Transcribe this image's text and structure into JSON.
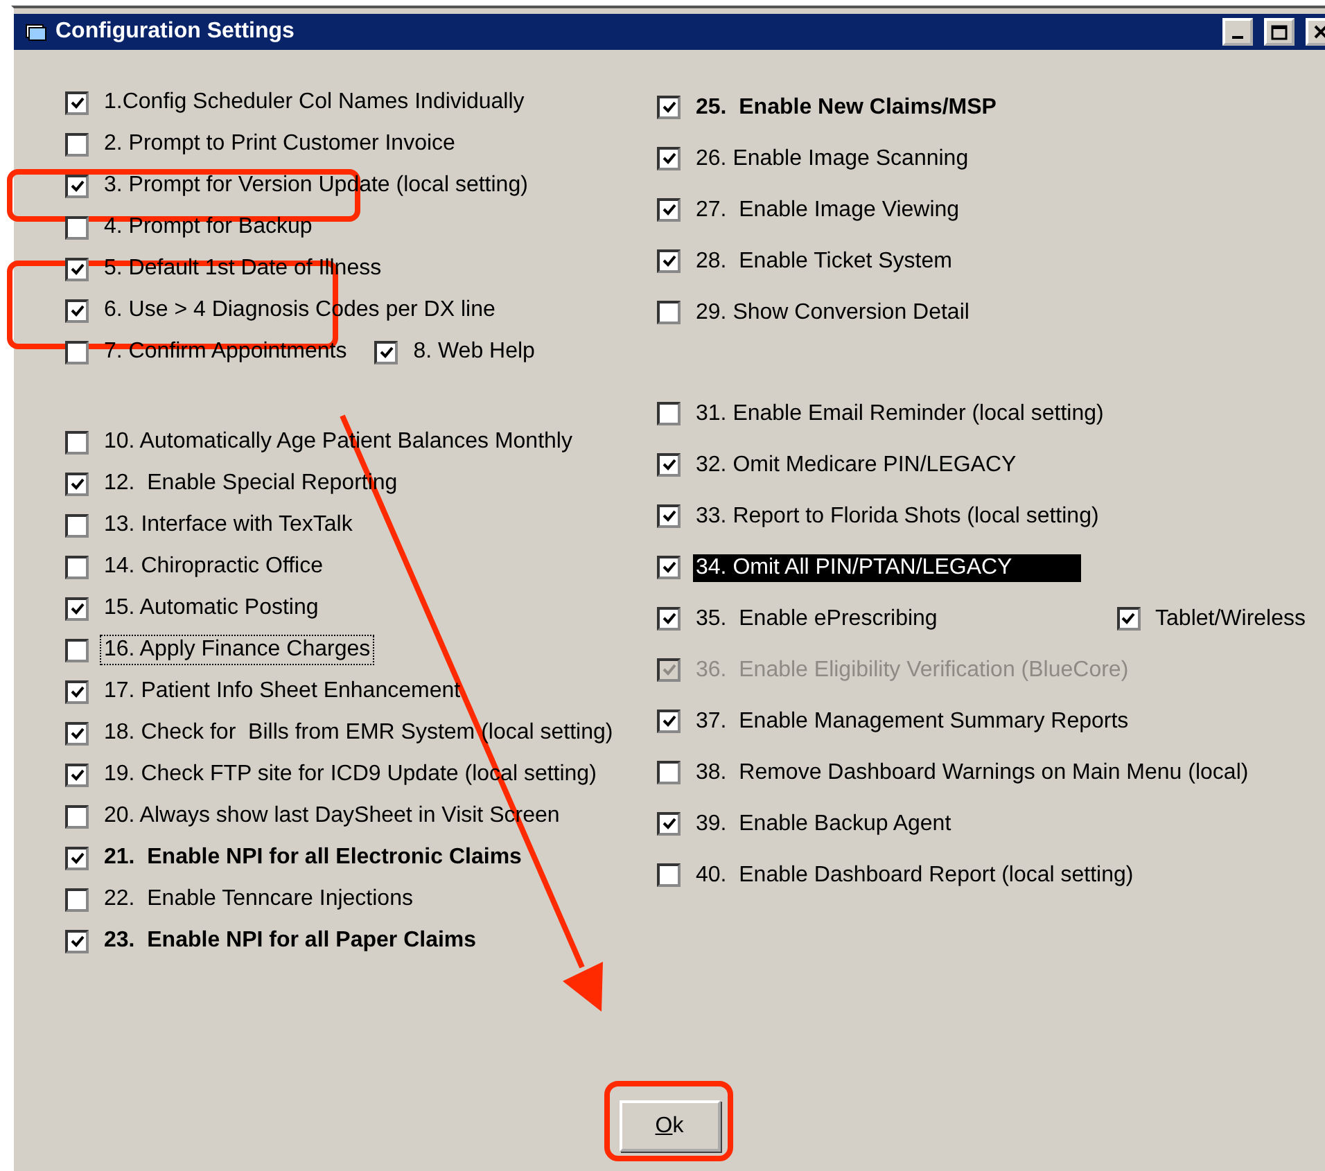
{
  "window": {
    "title": "Configuration Settings"
  },
  "columns": [
    {
      "groups": [
        [
          {
            "options": [
              {
                "label": "1.Config Scheduler Col Names Individually",
                "checked": true
              }
            ]
          },
          {
            "options": [
              {
                "label": "2. Prompt to Print Customer Invoice",
                "checked": false
              }
            ]
          },
          {
            "options": [
              {
                "label": "3. Prompt for Version Update (local setting)",
                "checked": true
              }
            ]
          },
          {
            "options": [
              {
                "label": "4. Prompt for Backup",
                "checked": false
              }
            ]
          },
          {
            "options": [
              {
                "label": "5. Default 1st Date of Illness",
                "checked": true
              }
            ]
          },
          {
            "options": [
              {
                "label": "6. Use > 4 Diagnosis Codes per DX line",
                "checked": true
              }
            ]
          },
          {
            "options": [
              {
                "label": "7. Confirm Appointments",
                "checked": false
              },
              {
                "label": "8. Web Help",
                "checked": true
              }
            ]
          }
        ],
        [
          {
            "options": [
              {
                "label": "10. Automatically Age Patient Balances Monthly",
                "checked": false
              }
            ]
          },
          {
            "options": [
              {
                "label": "12.  Enable Special Reporting",
                "checked": true
              }
            ]
          },
          {
            "options": [
              {
                "label": "13. Interface with TexTalk",
                "checked": false
              }
            ]
          },
          {
            "options": [
              {
                "label": "14. Chiropractic Office",
                "checked": false
              }
            ]
          },
          {
            "options": [
              {
                "label": "15. Automatic Posting",
                "checked": true
              }
            ]
          },
          {
            "options": [
              {
                "label": "16. Apply Finance Charges",
                "checked": false,
                "focused": true
              }
            ]
          },
          {
            "options": [
              {
                "label": "17. Patient Info Sheet Enhancement",
                "checked": true
              }
            ]
          },
          {
            "options": [
              {
                "label": "18. Check for  Bills from EMR System (local setting)",
                "checked": true
              }
            ]
          },
          {
            "options": [
              {
                "label": "19. Check FTP site for ICD9 Update (local setting)",
                "checked": true
              }
            ]
          },
          {
            "options": [
              {
                "label": "20. Always show last DaySheet in Visit Screen",
                "checked": false
              }
            ]
          },
          {
            "options": [
              {
                "label": "21.  Enable NPI for all Electronic Claims",
                "checked": true,
                "bold": true
              }
            ]
          },
          {
            "options": [
              {
                "label": "22.  Enable Tenncare Injections",
                "checked": false
              }
            ]
          },
          {
            "options": [
              {
                "label": "23.  Enable NPI for all Paper Claims",
                "checked": true,
                "bold": true
              }
            ]
          }
        ]
      ]
    },
    {
      "groups": [
        [
          {
            "options": [
              {
                "label": "25.  Enable New Claims/MSP",
                "checked": true,
                "bold": true
              }
            ]
          },
          {
            "options": [
              {
                "label": "26. Enable Image Scanning",
                "checked": true
              }
            ]
          },
          {
            "options": [
              {
                "label": "27.  Enable Image Viewing",
                "checked": true
              }
            ]
          },
          {
            "options": [
              {
                "label": "28.  Enable Ticket System",
                "checked": true
              }
            ]
          },
          {
            "options": [
              {
                "label": "29. Show Conversion Detail",
                "checked": false
              }
            ]
          }
        ],
        [
          {
            "options": [
              {
                "label": "31. Enable Email Reminder (local setting)",
                "checked": false
              }
            ]
          },
          {
            "options": [
              {
                "label": "32. Omit Medicare PIN/LEGACY",
                "checked": true
              }
            ]
          },
          {
            "options": [
              {
                "label": "33. Report to Florida Shots (local setting)",
                "checked": true
              }
            ]
          },
          {
            "options": [
              {
                "label": "34. Omit All PIN/PTAN/LEGACY",
                "checked": true,
                "highlighted": true
              }
            ]
          },
          {
            "options": [
              {
                "label": "35.  Enable ePrescribing",
                "checked": true
              },
              {
                "label": "Tablet/Wireless",
                "checked": true
              }
            ]
          },
          {
            "options": [
              {
                "label": "36.  Enable Eligibility Verification (BlueCore)",
                "checked": true,
                "disabled": true
              }
            ]
          },
          {
            "options": [
              {
                "label": "37.  Enable Management Summary Reports",
                "checked": true
              }
            ]
          },
          {
            "options": [
              {
                "label": "38.  Remove Dashboard Warnings on Main Menu (local)",
                "checked": false
              }
            ]
          },
          {
            "options": [
              {
                "label": "39.  Enable Backup Agent",
                "checked": true
              }
            ]
          },
          {
            "options": [
              {
                "label": "40.  Enable Dashboard Report (local setting)",
                "checked": false
              }
            ]
          }
        ]
      ]
    }
  ],
  "ok_button": {
    "label": "Ok"
  }
}
